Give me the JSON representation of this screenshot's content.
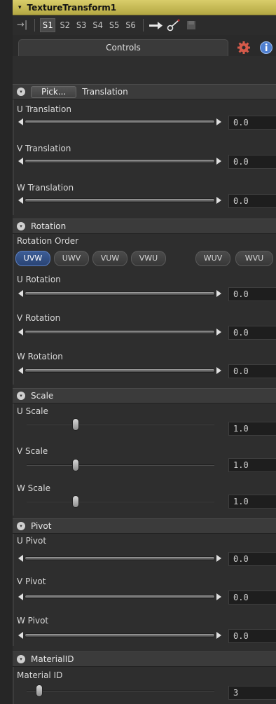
{
  "node": {
    "title": "TextureTransform1",
    "caret": "▾"
  },
  "toolbar": {
    "slots": [
      "S1",
      "S2",
      "S3",
      "S4",
      "S5",
      "S6"
    ],
    "active_slot": "S1"
  },
  "tabs": {
    "controls_label": "Controls"
  },
  "sections": {
    "translation": {
      "pick_label": "Pick...",
      "title": "Translation",
      "controls": [
        {
          "label": "U Translation",
          "value": "0.0"
        },
        {
          "label": "V Translation",
          "value": "0.0"
        },
        {
          "label": "W Translation",
          "value": "0.0"
        }
      ]
    },
    "rotation": {
      "title": "Rotation",
      "order_label": "Rotation Order",
      "orders": [
        "UVW",
        "UWV",
        "VUW",
        "VWU",
        "WUV",
        "WVU"
      ],
      "active_order": "UVW",
      "controls": [
        {
          "label": "U Rotation",
          "value": "0.0"
        },
        {
          "label": "V Rotation",
          "value": "0.0"
        },
        {
          "label": "W Rotation",
          "value": "0.0"
        }
      ]
    },
    "scale": {
      "title": "Scale",
      "controls": [
        {
          "label": "U Scale",
          "value": "1.0",
          "slider_fraction": 0.25
        },
        {
          "label": "V Scale",
          "value": "1.0",
          "slider_fraction": 0.25
        },
        {
          "label": "W Scale",
          "value": "1.0",
          "slider_fraction": 0.25
        }
      ]
    },
    "pivot": {
      "title": "Pivot",
      "controls": [
        {
          "label": "U Pivot",
          "value": "0.0"
        },
        {
          "label": "V Pivot",
          "value": "0.0"
        },
        {
          "label": "W Pivot",
          "value": "0.0"
        }
      ]
    },
    "materialid": {
      "title": "MaterialID",
      "controls": [
        {
          "label": "Material ID",
          "value": "3",
          "slider_fraction": 0.05
        }
      ]
    }
  },
  "colors": {
    "title_bg": "#c9bd55",
    "active_order": "#3c5d96",
    "gear_icon": "#d45a4a",
    "info_icon": "#4f7fd0"
  }
}
